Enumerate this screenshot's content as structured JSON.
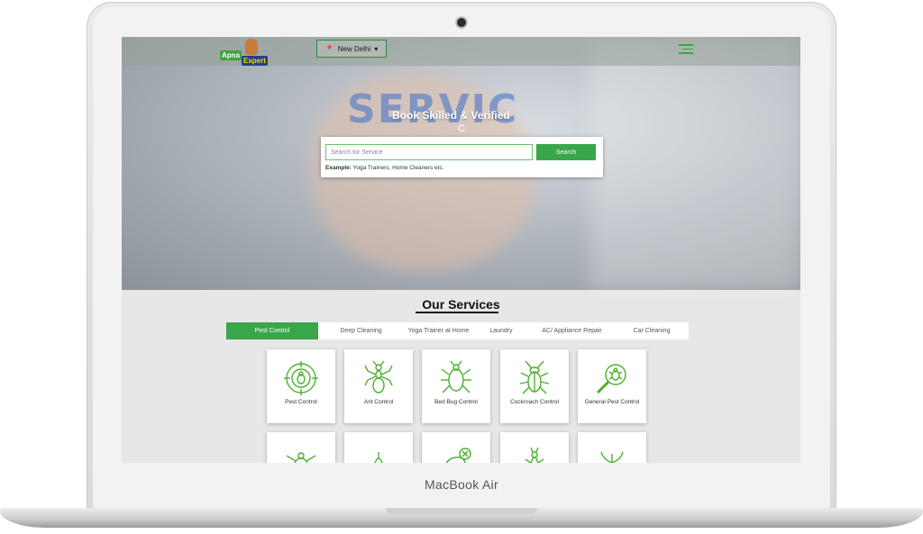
{
  "device": {
    "label": "MacBook Air"
  },
  "header": {
    "logo_top": "Apna",
    "logo_bottom": "Expert",
    "location": "New Delhi",
    "location_caret": "▾"
  },
  "hero": {
    "background_text": "SERVIC",
    "headline": "Book Skilled & Verified",
    "headline_caret": "C",
    "search": {
      "placeholder": "Search for Service",
      "button_label": "Search",
      "example_label": "Example:",
      "example_text": "Yoga Trainers, Home Cleaners etc."
    }
  },
  "services": {
    "title": "Our Services",
    "tabs": [
      {
        "label": "Pest Control",
        "active": true
      },
      {
        "label": "Deep Cleaning",
        "active": false
      },
      {
        "label": "Yoga Trainer at Home",
        "active": false
      },
      {
        "label": "Laundry",
        "active": false
      },
      {
        "label": "AC/ Appliance Repair",
        "active": false
      },
      {
        "label": "Car Cleaning",
        "active": false
      }
    ],
    "cards": [
      {
        "label": "Pest Control",
        "icon": "target-bug-icon"
      },
      {
        "label": "Ant Control",
        "icon": "ant-icon"
      },
      {
        "label": "Bed Bug Control",
        "icon": "bed-bug-icon"
      },
      {
        "label": "Cockroach Control",
        "icon": "cockroach-icon"
      },
      {
        "label": "General Pest Control",
        "icon": "magnifier-bug-icon"
      }
    ],
    "cards_row2_icons": [
      "spider-icon",
      "mosquito-icon",
      "rat-icon",
      "termite-icon",
      "plant-pest-icon"
    ]
  },
  "colors": {
    "accent": "#3aa64a",
    "icon_stroke": "#4caf2e",
    "navy": "#1f3f8a"
  }
}
